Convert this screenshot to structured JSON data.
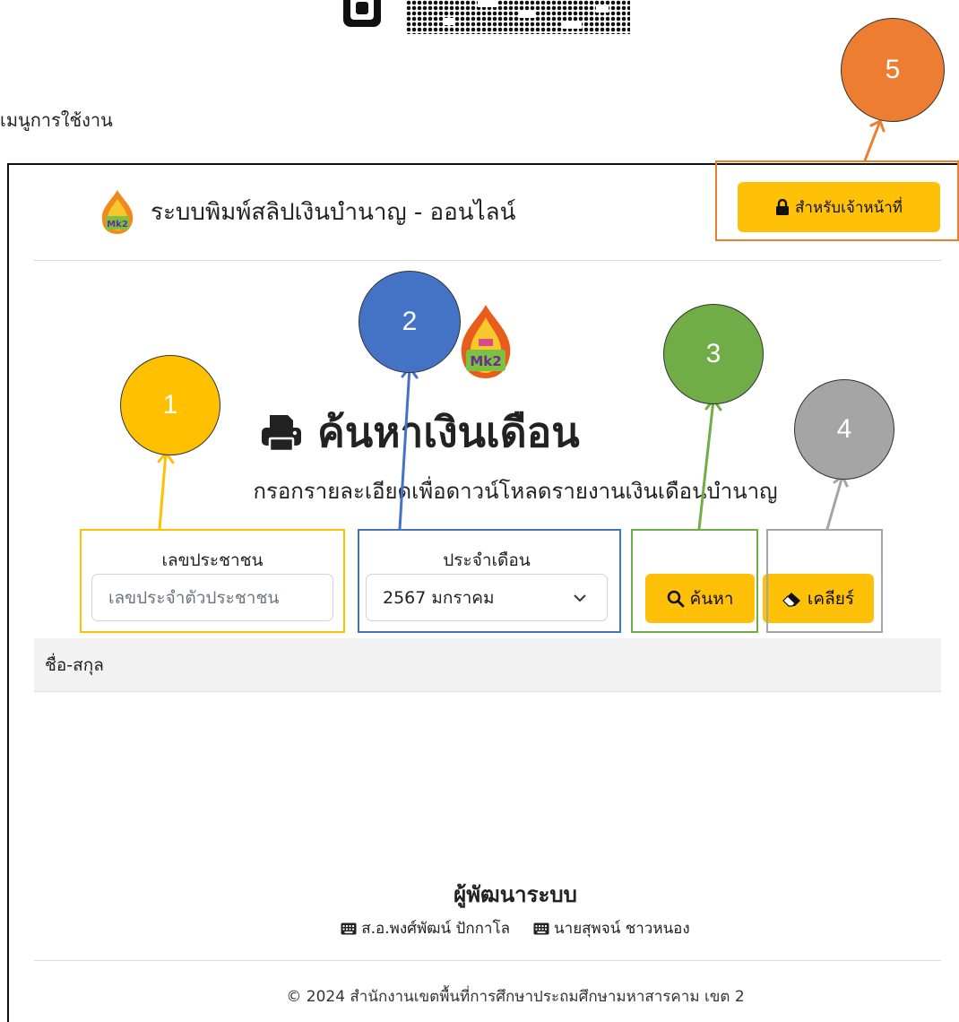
{
  "menu_caption": "เมนูการใช้งาน",
  "header": {
    "title": "ระบบพิมพ์สลิปเงินบำนาญ - ออนไลน์",
    "staff_button": "สำหรับเจ้าหน้าที่"
  },
  "main": {
    "title": "ค้นหาเงินเดือน",
    "subtitle": "กรอกรายละเอียดเพื่อดาวน์โหลดรายงานเงินเดือนบำนาญ",
    "citizen_label": "เลขประชาชน",
    "citizen_placeholder": "เลขประจำตัวประชาชน",
    "month_label": "ประจำเดือน",
    "month_value": "2567 มกราคม",
    "search_button": "ค้นหา",
    "clear_button": "เคลียร์"
  },
  "table": {
    "columns": [
      "ชื่อ-สกุล"
    ]
  },
  "developers": {
    "title": "ผู้พัฒนาระบบ",
    "names": [
      "ส.อ.พงศ์พัฒน์ ปักกาโล",
      "นายสุพจน์ ชาวหนอง"
    ]
  },
  "footer": "© 2024 สำนักงานเขตพื้นที่การศึกษาประถมศึกษามหาสารคาม เขต 2",
  "logo_text": "Mk2",
  "annotations": [
    {
      "number": "1",
      "color": "#ffc000"
    },
    {
      "number": "2",
      "color": "#4472c4"
    },
    {
      "number": "3",
      "color": "#70ad47"
    },
    {
      "number": "4",
      "color": "#a5a5a5"
    },
    {
      "number": "5",
      "color": "#ed7d31"
    }
  ],
  "colors": {
    "accent": "#ffc107"
  }
}
